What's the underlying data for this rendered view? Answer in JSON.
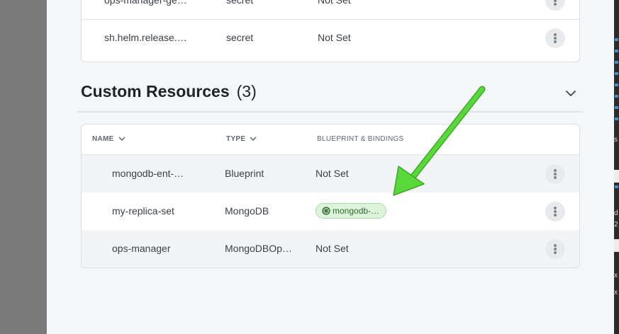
{
  "secrets_table": {
    "rows": [
      {
        "name": "ops-manager-ge…",
        "type": "secret",
        "binding": "Not Set"
      },
      {
        "name": "sh.helm.release.…",
        "type": "secret",
        "binding": "Not Set"
      }
    ]
  },
  "custom_resources": {
    "title": "Custom Resources",
    "count": "(3)",
    "columns": {
      "name": "NAME",
      "type": "TYPE",
      "blueprint": "BLUEPRINT & BINDINGS"
    },
    "rows": [
      {
        "name": "mongodb-ent-…",
        "type": "Blueprint",
        "binding": "Not Set"
      },
      {
        "name": "my-replica-set",
        "type": "MongoDB",
        "binding_chip": "mongodb-…"
      },
      {
        "name": "ops-manager",
        "type": "MongoDBOp…",
        "binding": "Not Set"
      }
    ]
  },
  "right_strip": {
    "labels": [
      "s",
      "d",
      "2",
      "x",
      "x"
    ]
  },
  "colors": {
    "chip_bg": "#ddf3dc",
    "arrow": "#5ad83a",
    "panel_bg": "#f5f6f7"
  },
  "icons": {
    "kebab": "more-vertical-icon",
    "sort": "chevron-down-icon",
    "collapse": "chevron-down-icon",
    "chip": "blueprint-icon"
  }
}
